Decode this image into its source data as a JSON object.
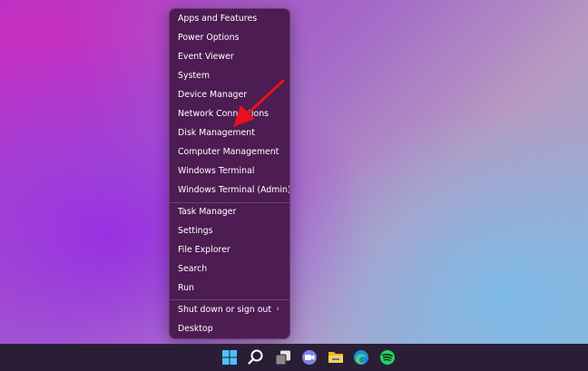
{
  "menu": {
    "items": [
      {
        "label": "Apps and Features"
      },
      {
        "label": "Power Options"
      },
      {
        "label": "Event Viewer"
      },
      {
        "label": "System"
      },
      {
        "label": "Device Manager"
      },
      {
        "label": "Network Connections"
      },
      {
        "label": "Disk Management"
      },
      {
        "label": "Computer Management"
      },
      {
        "label": "Windows Terminal"
      },
      {
        "label": "Windows Terminal (Admin)"
      },
      {
        "label": "Task Manager"
      },
      {
        "label": "Settings"
      },
      {
        "label": "File Explorer"
      },
      {
        "label": "Search"
      },
      {
        "label": "Run"
      },
      {
        "label": "Shut down or sign out"
      },
      {
        "label": "Desktop"
      }
    ],
    "submenu_indicator": "›"
  },
  "taskbar": {
    "icons": [
      "start-icon",
      "search-icon",
      "task-view-icon",
      "chat-icon",
      "file-explorer-icon",
      "edge-icon",
      "spotify-icon"
    ]
  },
  "colors": {
    "accent_arrow": "#e8101e",
    "menu_bg": "#4c1c53",
    "taskbar_bg": "#2a1e36"
  }
}
